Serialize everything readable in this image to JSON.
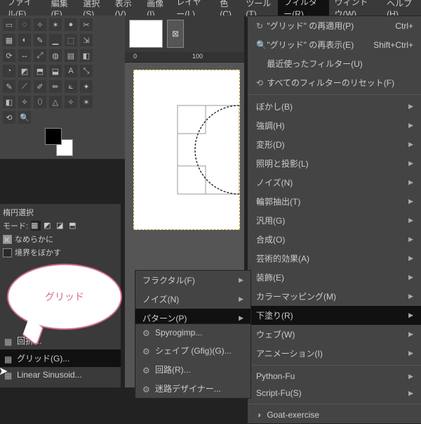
{
  "menubar": [
    "ファイル(F)",
    "編集(E)",
    "選択(S)",
    "表示(V)",
    "画像(I)",
    "レイヤー(L)",
    "色(C)",
    "ツール(T)",
    "フィルター(R)",
    "ウィンドウ(W)",
    "ヘルプ(H)"
  ],
  "menubar_active": 8,
  "filter_top": [
    {
      "icon": "↻",
      "label": "\"グリッド\" の再適用(P)",
      "accel": "Ctrl+"
    },
    {
      "icon": "🔍",
      "label": "\"グリッド\" の再表示(E)",
      "accel": "Shift+Ctrl+"
    },
    {
      "icon": "",
      "label": "最近使ったフィルター(U)",
      "accel": ""
    },
    {
      "icon": "⟲",
      "label": "すべてのフィルターのリセット(F)",
      "accel": ""
    }
  ],
  "filter_main": [
    "ぼかし(B)",
    "強調(H)",
    "変形(D)",
    "照明と投影(L)",
    "ノイズ(N)",
    "輪郭抽出(T)",
    "汎用(G)",
    "合成(O)",
    "芸術的効果(A)",
    "装飾(E)",
    "カラーマッピング(M)",
    "下塗り(R)",
    "ウェブ(W)",
    "アニメーション(I)"
  ],
  "filter_main_sel": 11,
  "filter_bottom": [
    "Python-Fu",
    "Script-Fu(S)"
  ],
  "filter_last": "Goat-exercise",
  "submenu1": [
    "フラクタル(F)",
    "ノイズ(N)",
    "パターン(P)"
  ],
  "submenu1_sel": 2,
  "submenu2": [
    "Spyrogimp...",
    "シェイプ (Gfig)(G)...",
    "回路(R)...",
    "迷路デザイナー..."
  ],
  "ruler": [
    "0",
    "100"
  ],
  "opts_title": "楕円選択",
  "opts_mode": "モード:",
  "opts_items": [
    "なめらかに",
    "境界をぼかす"
  ],
  "bubble": "グリッド",
  "list": [
    "回折…",
    "グリッド(G)...",
    "Linear Sinusoid..."
  ],
  "list_sel": 1,
  "tool_glyphs": [
    [
      "▭",
      "◌",
      "✧",
      "✶",
      "●",
      "✂"
    ],
    [
      "▦",
      "◐",
      "✎",
      "▁",
      "⬚",
      "⇲"
    ],
    [
      "⟳",
      "↔",
      "⤢",
      "◍",
      "▤",
      "◧"
    ],
    [
      "◔",
      "◩",
      "⬒",
      "⬓",
      "A",
      "⤡"
    ],
    [
      "✎",
      "⟋",
      "✐",
      "✏",
      "⟀",
      "✦"
    ],
    [
      "◧",
      "⟡",
      "⬯",
      "△",
      "✧",
      "✶"
    ],
    [
      "⟲",
      "🔍",
      "",
      "",
      "",
      ""
    ]
  ]
}
